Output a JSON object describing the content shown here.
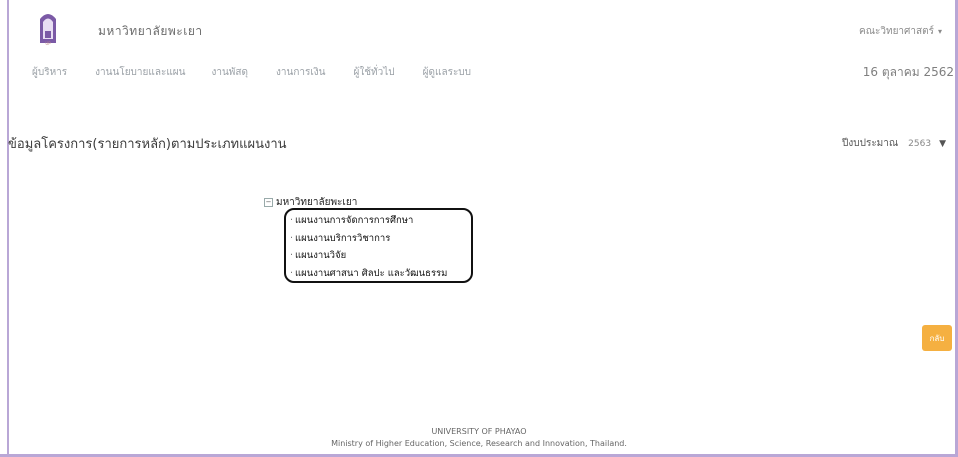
{
  "header": {
    "app_title": "มหาวิทยาลัยพะเยา",
    "user_menu": "คณะวิทยาศาสตร์",
    "logo_text": "UP"
  },
  "nav": {
    "items": [
      {
        "label": "ผู้บริหาร"
      },
      {
        "label": "งานนโยบายและแผน"
      },
      {
        "label": "งานพัสดุ"
      },
      {
        "label": "งานการเงิน"
      },
      {
        "label": "ผู้ใช้ทั่วไป"
      },
      {
        "label": "ผู้ดูแลระบบ"
      }
    ],
    "date": "16 ตุลาคม 2562"
  },
  "main": {
    "title": "ข้อมูลโครงการ(รายการหลัก)ตามประเภทแผนงาน",
    "budget_year_label": "ปีงบประมาณ",
    "budget_year_value": "2563",
    "tree": {
      "root": "มหาวิทยาลัยพะเยา",
      "children": [
        {
          "label": "แผนงานการจัดการการศึกษา"
        },
        {
          "label": "แผนงานบริการวิชาการ"
        },
        {
          "label": "แผนงานวิจัย"
        },
        {
          "label": "แผนงานศาสนา ศิลปะ และวัฒนธรรม"
        }
      ]
    },
    "back_label": "กลับ"
  },
  "footer": {
    "line1": "UNIVERSITY OF PHAYAO",
    "line2": "Ministry of Higher Education, Science, Research and Innovation, Thailand."
  },
  "colors": {
    "frame": "#b9a7d6",
    "back_button": "#f5b041",
    "logo": "#7b5aa6"
  }
}
